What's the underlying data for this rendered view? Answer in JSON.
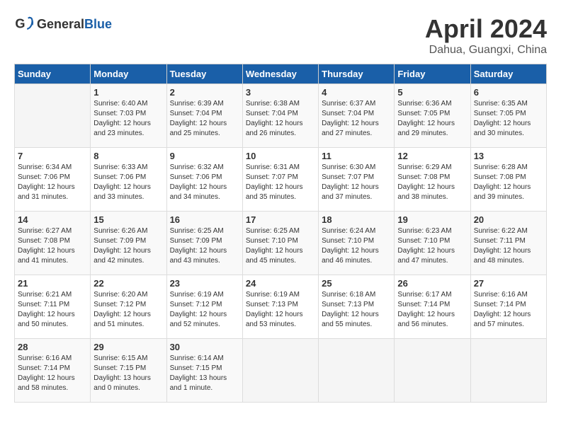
{
  "header": {
    "logo_general": "General",
    "logo_blue": "Blue",
    "month": "April 2024",
    "location": "Dahua, Guangxi, China"
  },
  "weekdays": [
    "Sunday",
    "Monday",
    "Tuesday",
    "Wednesday",
    "Thursday",
    "Friday",
    "Saturday"
  ],
  "weeks": [
    [
      {
        "day": "",
        "sunrise": "",
        "sunset": "",
        "daylight": ""
      },
      {
        "day": "1",
        "sunrise": "Sunrise: 6:40 AM",
        "sunset": "Sunset: 7:03 PM",
        "daylight": "Daylight: 12 hours and 23 minutes."
      },
      {
        "day": "2",
        "sunrise": "Sunrise: 6:39 AM",
        "sunset": "Sunset: 7:04 PM",
        "daylight": "Daylight: 12 hours and 25 minutes."
      },
      {
        "day": "3",
        "sunrise": "Sunrise: 6:38 AM",
        "sunset": "Sunset: 7:04 PM",
        "daylight": "Daylight: 12 hours and 26 minutes."
      },
      {
        "day": "4",
        "sunrise": "Sunrise: 6:37 AM",
        "sunset": "Sunset: 7:04 PM",
        "daylight": "Daylight: 12 hours and 27 minutes."
      },
      {
        "day": "5",
        "sunrise": "Sunrise: 6:36 AM",
        "sunset": "Sunset: 7:05 PM",
        "daylight": "Daylight: 12 hours and 29 minutes."
      },
      {
        "day": "6",
        "sunrise": "Sunrise: 6:35 AM",
        "sunset": "Sunset: 7:05 PM",
        "daylight": "Daylight: 12 hours and 30 minutes."
      }
    ],
    [
      {
        "day": "7",
        "sunrise": "Sunrise: 6:34 AM",
        "sunset": "Sunset: 7:06 PM",
        "daylight": "Daylight: 12 hours and 31 minutes."
      },
      {
        "day": "8",
        "sunrise": "Sunrise: 6:33 AM",
        "sunset": "Sunset: 7:06 PM",
        "daylight": "Daylight: 12 hours and 33 minutes."
      },
      {
        "day": "9",
        "sunrise": "Sunrise: 6:32 AM",
        "sunset": "Sunset: 7:06 PM",
        "daylight": "Daylight: 12 hours and 34 minutes."
      },
      {
        "day": "10",
        "sunrise": "Sunrise: 6:31 AM",
        "sunset": "Sunset: 7:07 PM",
        "daylight": "Daylight: 12 hours and 35 minutes."
      },
      {
        "day": "11",
        "sunrise": "Sunrise: 6:30 AM",
        "sunset": "Sunset: 7:07 PM",
        "daylight": "Daylight: 12 hours and 37 minutes."
      },
      {
        "day": "12",
        "sunrise": "Sunrise: 6:29 AM",
        "sunset": "Sunset: 7:08 PM",
        "daylight": "Daylight: 12 hours and 38 minutes."
      },
      {
        "day": "13",
        "sunrise": "Sunrise: 6:28 AM",
        "sunset": "Sunset: 7:08 PM",
        "daylight": "Daylight: 12 hours and 39 minutes."
      }
    ],
    [
      {
        "day": "14",
        "sunrise": "Sunrise: 6:27 AM",
        "sunset": "Sunset: 7:08 PM",
        "daylight": "Daylight: 12 hours and 41 minutes."
      },
      {
        "day": "15",
        "sunrise": "Sunrise: 6:26 AM",
        "sunset": "Sunset: 7:09 PM",
        "daylight": "Daylight: 12 hours and 42 minutes."
      },
      {
        "day": "16",
        "sunrise": "Sunrise: 6:25 AM",
        "sunset": "Sunset: 7:09 PM",
        "daylight": "Daylight: 12 hours and 43 minutes."
      },
      {
        "day": "17",
        "sunrise": "Sunrise: 6:25 AM",
        "sunset": "Sunset: 7:10 PM",
        "daylight": "Daylight: 12 hours and 45 minutes."
      },
      {
        "day": "18",
        "sunrise": "Sunrise: 6:24 AM",
        "sunset": "Sunset: 7:10 PM",
        "daylight": "Daylight: 12 hours and 46 minutes."
      },
      {
        "day": "19",
        "sunrise": "Sunrise: 6:23 AM",
        "sunset": "Sunset: 7:10 PM",
        "daylight": "Daylight: 12 hours and 47 minutes."
      },
      {
        "day": "20",
        "sunrise": "Sunrise: 6:22 AM",
        "sunset": "Sunset: 7:11 PM",
        "daylight": "Daylight: 12 hours and 48 minutes."
      }
    ],
    [
      {
        "day": "21",
        "sunrise": "Sunrise: 6:21 AM",
        "sunset": "Sunset: 7:11 PM",
        "daylight": "Daylight: 12 hours and 50 minutes."
      },
      {
        "day": "22",
        "sunrise": "Sunrise: 6:20 AM",
        "sunset": "Sunset: 7:12 PM",
        "daylight": "Daylight: 12 hours and 51 minutes."
      },
      {
        "day": "23",
        "sunrise": "Sunrise: 6:19 AM",
        "sunset": "Sunset: 7:12 PM",
        "daylight": "Daylight: 12 hours and 52 minutes."
      },
      {
        "day": "24",
        "sunrise": "Sunrise: 6:19 AM",
        "sunset": "Sunset: 7:13 PM",
        "daylight": "Daylight: 12 hours and 53 minutes."
      },
      {
        "day": "25",
        "sunrise": "Sunrise: 6:18 AM",
        "sunset": "Sunset: 7:13 PM",
        "daylight": "Daylight: 12 hours and 55 minutes."
      },
      {
        "day": "26",
        "sunrise": "Sunrise: 6:17 AM",
        "sunset": "Sunset: 7:14 PM",
        "daylight": "Daylight: 12 hours and 56 minutes."
      },
      {
        "day": "27",
        "sunrise": "Sunrise: 6:16 AM",
        "sunset": "Sunset: 7:14 PM",
        "daylight": "Daylight: 12 hours and 57 minutes."
      }
    ],
    [
      {
        "day": "28",
        "sunrise": "Sunrise: 6:16 AM",
        "sunset": "Sunset: 7:14 PM",
        "daylight": "Daylight: 12 hours and 58 minutes."
      },
      {
        "day": "29",
        "sunrise": "Sunrise: 6:15 AM",
        "sunset": "Sunset: 7:15 PM",
        "daylight": "Daylight: 13 hours and 0 minutes."
      },
      {
        "day": "30",
        "sunrise": "Sunrise: 6:14 AM",
        "sunset": "Sunset: 7:15 PM",
        "daylight": "Daylight: 13 hours and 1 minute."
      },
      {
        "day": "",
        "sunrise": "",
        "sunset": "",
        "daylight": ""
      },
      {
        "day": "",
        "sunrise": "",
        "sunset": "",
        "daylight": ""
      },
      {
        "day": "",
        "sunrise": "",
        "sunset": "",
        "daylight": ""
      },
      {
        "day": "",
        "sunrise": "",
        "sunset": "",
        "daylight": ""
      }
    ]
  ]
}
